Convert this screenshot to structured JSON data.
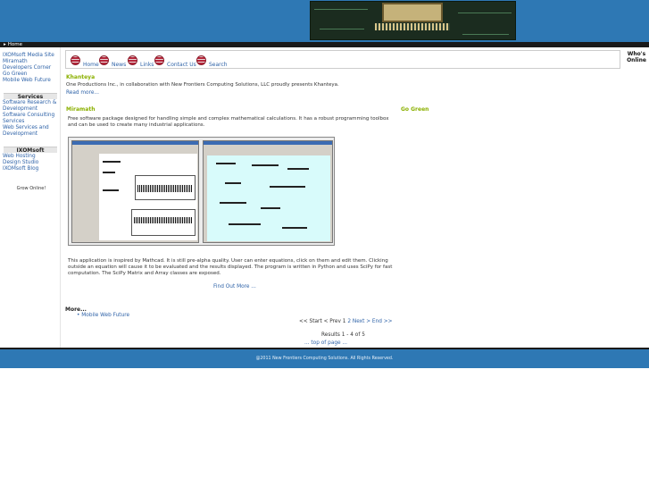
{
  "breadcrumb": {
    "arrow": "▸",
    "home": "Home"
  },
  "sidebar": {
    "links": [
      "IXOMsoft Media Site",
      "Miramath",
      "Developers Corner",
      "Go Green",
      "Mobile Web Future"
    ],
    "services_title": "Services",
    "services": [
      "Software Research & Development",
      "Software Consulting Services",
      "Web Services and Development"
    ],
    "ixomsoft_title": "IXOMsoft",
    "ixomsoft": [
      "Web Hosting",
      "Design Studio",
      "IXOMsoft Blog"
    ],
    "grow": "Grow Online!"
  },
  "nav": {
    "items": [
      "Home",
      "News",
      "Links",
      "Contact Us",
      "Search"
    ]
  },
  "whos_online": "Who's Online",
  "articles": {
    "khanteya_title": "Khanteya",
    "khanteya_text": "One Productions Inc., in collaboration with New Frontiers Computing Solutions, LLC proudly presents Khanteya.",
    "read_more": "Read more...",
    "miramath_title": "Miramath",
    "go_green": "Go Green",
    "miramath_text": "Free software package designed for handling simple and complex mathematical calculations. It has a robust programming toolbox and can be used to create many industrial applications.",
    "miramath_text2": "This application is inspired by Mathcad. It is still pre-alpha quality. User can enter equations, click on them and edit them. Clicking outside an equation will cause it to be evaluated and the results displayed.  The program is written in Python and uses SciPy for fast computation.  The SciPy Matrix and Array classes are exposed.",
    "find_out_more": "Find Out More ..."
  },
  "more": {
    "title": "More...",
    "items": [
      "Mobile Web Future"
    ]
  },
  "pagination": {
    "start": "<< Start",
    "prev": "< Prev",
    "p1": "1",
    "p2": "2",
    "next": "Next >",
    "end": "End >>",
    "results": "Results 1 - 4 of 5"
  },
  "top_of_page": "... top of page ...",
  "footer": "@2011 New Frontiers Computing Solutions. All Rights Reserved."
}
